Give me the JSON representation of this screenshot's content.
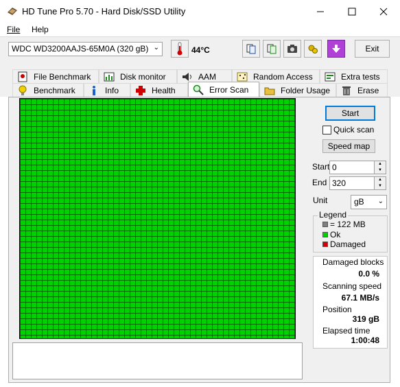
{
  "window": {
    "title": "HD Tune Pro 5.70 - Hard Disk/SSD Utility"
  },
  "menu": {
    "file": "File",
    "help": "Help"
  },
  "toolbar": {
    "drive": "WDC WD3200AAJS-65M0A (320 gB)",
    "temperature": "44°C",
    "exit_label": "Exit"
  },
  "tabs": {
    "row1": [
      "File Benchmark",
      "Disk monitor",
      "AAM",
      "Random Access",
      "Extra tests"
    ],
    "row2": [
      "Benchmark",
      "Info",
      "Health",
      "Error Scan",
      "Folder Usage",
      "Erase"
    ],
    "active": "Error Scan"
  },
  "scan": {
    "start_label": "Start",
    "quick_scan_label": "Quick scan",
    "quick_scan_checked": false,
    "speed_map_label": "Speed map",
    "start_field_label": "Start",
    "start_value": "0",
    "end_field_label": "End",
    "end_value": "320",
    "unit_label": "Unit",
    "unit_value": "gB"
  },
  "legend": {
    "title": "Legend",
    "block_size": "= 122 MB",
    "ok": "Ok",
    "damaged": "Damaged",
    "colors": {
      "block": "#808080",
      "ok": "#00d200",
      "damaged": "#d20000"
    }
  },
  "stats": {
    "damaged_label": "Damaged blocks",
    "damaged_value": "0.0 %",
    "speed_label": "Scanning speed",
    "speed_value": "67.1 MB/s",
    "position_label": "Position",
    "position_value": "319 gB",
    "elapsed_label": "Elapsed time",
    "elapsed_value": "1:00:48"
  }
}
